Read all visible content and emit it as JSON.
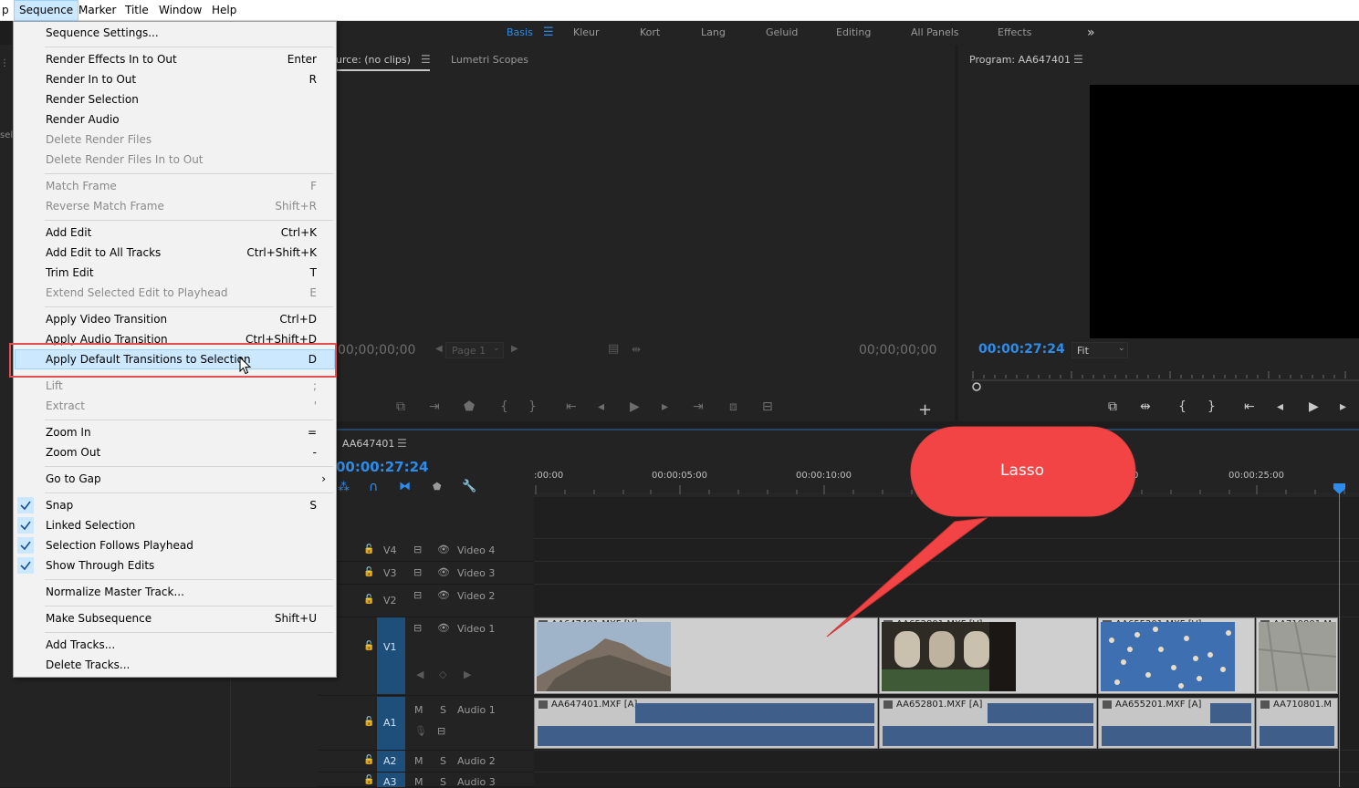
{
  "menubar": [
    {
      "label": "p",
      "open": false
    },
    {
      "label": "Sequence",
      "open": true
    },
    {
      "label": "Marker",
      "open": false
    },
    {
      "label": "Title",
      "open": false
    },
    {
      "label": "Window",
      "open": false
    },
    {
      "label": "Help",
      "open": false
    }
  ],
  "workspaces": [
    "Basis",
    "Kleur",
    "Kort",
    "Lang",
    "Geluid",
    "Editing",
    "All Panels",
    "Effects"
  ],
  "workspace_active": "Basis",
  "left_panel": {
    "fragment": "sele"
  },
  "source_monitor": {
    "tab_label": "urce: (no clips)",
    "tab2_label": "Lumetri Scopes",
    "timecode_in": "00;00;00;00",
    "timecode_out": "00;00;00;00",
    "page_label": "Page 1"
  },
  "program_monitor": {
    "title": "Program: AA647401",
    "timecode": "00:00:27:24",
    "fit_label": "Fit"
  },
  "timeline": {
    "sequence_name": "AA647401",
    "timecode": "00:00:27:24",
    "ruler_labels": [
      ":00:00",
      "00:00:05:00",
      "00:00:10:00",
      "0",
      "00:00:25:00"
    ],
    "tracks": {
      "v4": {
        "id": "V4",
        "name": "Video 4"
      },
      "v3": {
        "id": "V3",
        "name": "Video 3"
      },
      "v2": {
        "id": "V2",
        "name": "Video 2"
      },
      "v1": {
        "id": "V1",
        "name": "Video 1"
      },
      "a1": {
        "id": "A1",
        "name": "Audio 1",
        "m": "M",
        "s": "S"
      },
      "a2": {
        "id": "A2",
        "name": "Audio 2",
        "m": "M",
        "s": "S"
      },
      "a3": {
        "id": "A3",
        "name": "Audio 3",
        "m": "M",
        "s": "S"
      }
    },
    "video_clips": [
      "AA647401.MXF [V]",
      "AA652801.MXF [V]",
      "AA655201.MXF [V]",
      "AA710801.M"
    ],
    "audio_clips": [
      "AA647401.MXF [A]",
      "AA652801.MXF [A]",
      "AA655201.MXF [A]",
      "AA710801.M"
    ]
  },
  "sequence_menu": [
    {
      "label": "Sequence Settings...",
      "shortcut": ""
    },
    {
      "label": "Render Effects In to Out",
      "shortcut": "Enter"
    },
    {
      "label": "Render In to Out",
      "shortcut": "R"
    },
    {
      "label": "Render Selection",
      "shortcut": ""
    },
    {
      "label": "Render Audio",
      "shortcut": ""
    },
    {
      "label": "Delete Render Files",
      "shortcut": "",
      "disabled": true
    },
    {
      "label": "Delete Render Files In to Out",
      "shortcut": "",
      "disabled": true
    },
    {
      "label": "Match Frame",
      "shortcut": "F",
      "disabled": true
    },
    {
      "label": "Reverse Match Frame",
      "shortcut": "Shift+R",
      "disabled": true
    },
    {
      "label": "Add Edit",
      "shortcut": "Ctrl+K"
    },
    {
      "label": "Add Edit to All Tracks",
      "shortcut": "Ctrl+Shift+K"
    },
    {
      "label": "Trim Edit",
      "shortcut": "T"
    },
    {
      "label": "Extend Selected Edit to Playhead",
      "shortcut": "E",
      "disabled": true
    },
    {
      "label": "Apply Video Transition",
      "shortcut": "Ctrl+D"
    },
    {
      "label": "Apply Audio Transition",
      "shortcut": "Ctrl+Shift+D"
    },
    {
      "label": "Apply Default Transitions to Selection",
      "shortcut": "D",
      "highlighted": true
    },
    {
      "label": "Lift",
      "shortcut": ";",
      "disabled": true
    },
    {
      "label": "Extract",
      "shortcut": "'",
      "disabled": true
    },
    {
      "label": "Zoom In",
      "shortcut": "="
    },
    {
      "label": "Zoom Out",
      "shortcut": "-"
    },
    {
      "label": "Go to Gap",
      "shortcut": "›"
    },
    {
      "label": "Snap",
      "shortcut": "S",
      "checked": true
    },
    {
      "label": "Linked Selection",
      "shortcut": "",
      "checked": true
    },
    {
      "label": "Selection Follows Playhead",
      "shortcut": "",
      "checked": true
    },
    {
      "label": "Show Through Edits",
      "shortcut": "",
      "checked": true
    },
    {
      "label": "Normalize Master Track...",
      "shortcut": ""
    },
    {
      "label": "Make Subsequence",
      "shortcut": "Shift+U"
    },
    {
      "label": "Add Tracks...",
      "shortcut": ""
    },
    {
      "label": "Delete Tracks...",
      "shortcut": ""
    }
  ],
  "callout": {
    "label": "Lasso"
  },
  "colors": {
    "accent": "#2d8ceb",
    "callout": "#f24444",
    "highlight_box": "#e05050",
    "track_target": "#1e4f7a"
  }
}
